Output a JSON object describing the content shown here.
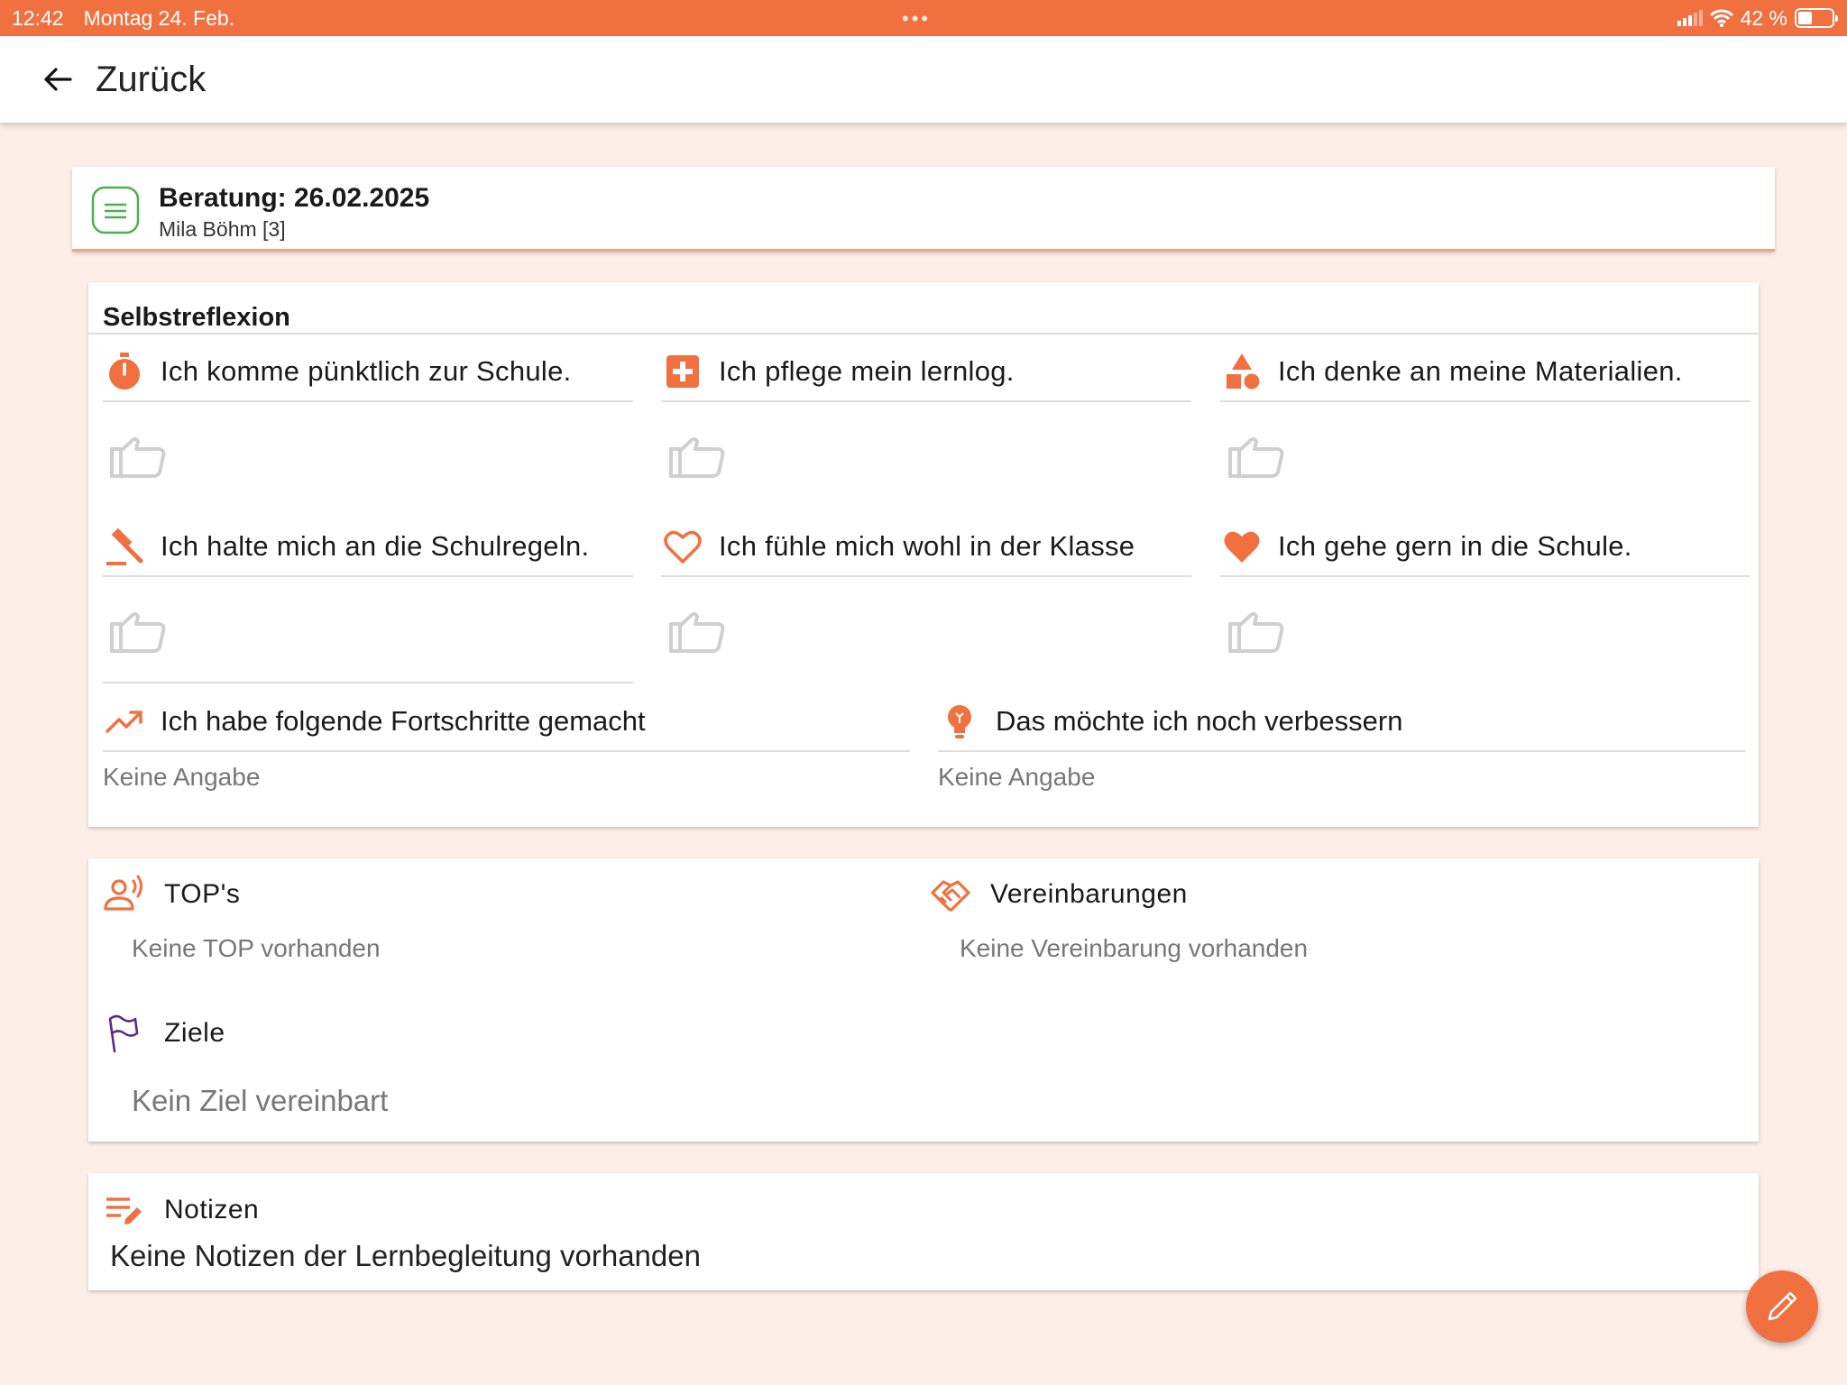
{
  "status": {
    "time": "12:42",
    "date": "Montag 24. Feb.",
    "battery": "42 %",
    "battery_level_pct": 42,
    "icons": [
      "signal-icon",
      "wifi-icon",
      "battery-icon"
    ]
  },
  "header": {
    "back_label": "Zurück",
    "back_icon": "arrow-left-icon"
  },
  "consultation": {
    "title": "Beratung: 26.02.2025",
    "student": "Mila Böhm [3]"
  },
  "selfreflection": {
    "title": "Selbstreflexion",
    "items": [
      {
        "label": "Ich komme pünktlich zur Schule.",
        "icon": "stopwatch-icon"
      },
      {
        "label": "Ich pflege mein lernlog.",
        "icon": "medical-plus-icon"
      },
      {
        "label": "Ich denke an meine Materialien.",
        "icon": "shapes-icon"
      },
      {
        "label": "Ich halte mich an die Schulregeln.",
        "icon": "gavel-icon"
      },
      {
        "label": "Ich fühle mich wohl in der Klasse",
        "icon": "heart-outline-icon"
      },
      {
        "label": "Ich gehe gern in die Schule.",
        "icon": "heart-filled-icon"
      }
    ],
    "progress": {
      "label": "Ich habe folgende Fortschritte gemacht",
      "value": "Keine Angabe",
      "icon": "trending-up-icon"
    },
    "improve": {
      "label": "Das möchte ich noch verbessern",
      "value": "Keine Angabe",
      "icon": "lightbulb-icon"
    }
  },
  "tops": {
    "title": "TOP's",
    "empty": "Keine TOP vorhanden",
    "icon": "speaker-person-icon"
  },
  "agreements": {
    "title": "Vereinbarungen",
    "empty": "Keine Vereinbarung vorhanden",
    "icon": "handshake-icon"
  },
  "goals": {
    "title": "Ziele",
    "empty": "Kein Ziel vereinbart",
    "icon": "flag-icon"
  },
  "notes": {
    "title": "Notizen",
    "empty": "Keine Notizen der Lernbegleitung vorhanden",
    "icon": "notes-edit-icon"
  },
  "fab": {
    "icon": "pencil-icon"
  },
  "colors": {
    "accent": "#f07040",
    "background": "#fdeee8",
    "doc_icon": "#4caf50",
    "flag": "#5b2a86"
  }
}
